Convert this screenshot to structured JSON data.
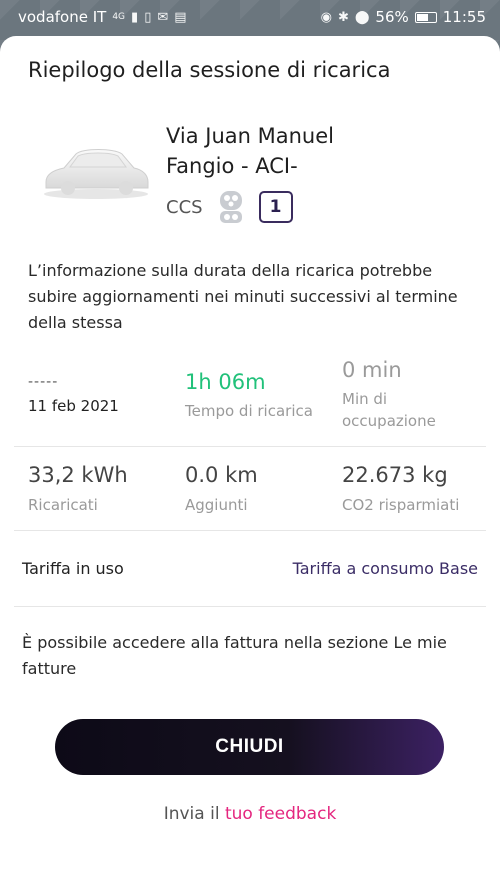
{
  "status_bar": {
    "carrier": "vodafone IT",
    "network": "4G",
    "battery": "56%",
    "time": "11:55"
  },
  "sheet": {
    "title": "Riepilogo della sessione di ricarica",
    "station": {
      "name": "Via Juan Manuel Fangio - ACI-",
      "connector": "CCS",
      "count": "1"
    },
    "info_text": "L’informazione sulla durata della ricarica potrebbe subire aggiornamenti nei minuti successivi al termine della stessa",
    "stats": {
      "start": {
        "dashes": "-----",
        "date": "11 feb 2021"
      },
      "charge_time": {
        "value": "1h 06m",
        "label": "Tempo di ricarica"
      },
      "occupancy": {
        "value": "0 min",
        "label": "Min di occupazione"
      },
      "energy": {
        "value": "33,2 kWh",
        "label": "Ricaricati"
      },
      "distance": {
        "value": "0.0 km",
        "label": "Aggiunti"
      },
      "co2": {
        "value": "22.673 kg",
        "label": "CO2 risparmiati"
      }
    },
    "tariff": {
      "label": "Tariffa in uso",
      "value": "Tariffa a consumo Base"
    },
    "invoice_text": "È possibile accedere alla fattura nella sezione Le mie fatture",
    "close_label": "CHIUDI",
    "feedback": {
      "prefix": "Invia il ",
      "link": "tuo feedback"
    }
  },
  "colors": {
    "accent_green": "#21c17a",
    "accent_purple": "#3b2d66",
    "link_pink": "#e4267f"
  }
}
